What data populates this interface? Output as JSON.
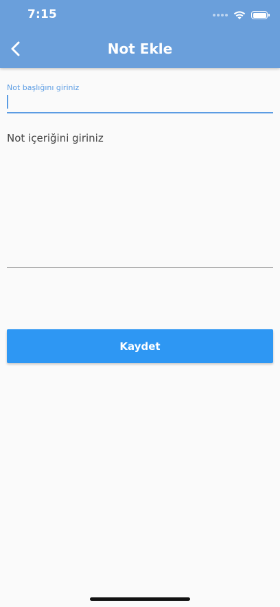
{
  "status_bar": {
    "time": "7:15",
    "icons": [
      "signal-icon",
      "wifi-icon",
      "battery-icon"
    ]
  },
  "header": {
    "title": "Not Ekle",
    "back_icon": "chevron-left-icon",
    "background_color": "#6a9fdb"
  },
  "form": {
    "title_field": {
      "label": "Not başlığını giriniz",
      "value": "",
      "accent_color": "#5b9ce3"
    },
    "content_field": {
      "placeholder": "Not içeriğini giriniz",
      "value": ""
    },
    "save_button": {
      "label": "Kaydet",
      "color": "#2e97f3"
    }
  }
}
